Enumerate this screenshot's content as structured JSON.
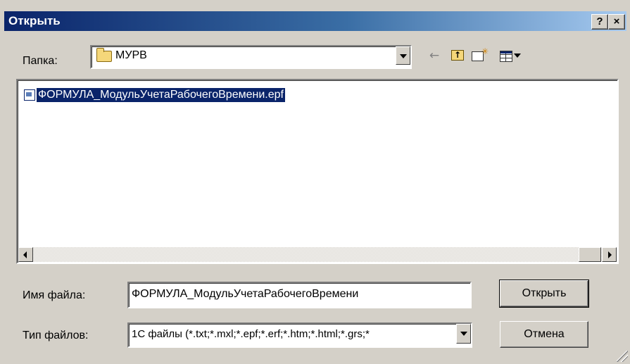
{
  "window": {
    "title": "Открыть",
    "help_label": "?",
    "close_label": "×"
  },
  "folder": {
    "label": "Папка:",
    "current": "МУРВ"
  },
  "toolbar": {
    "back_icon": "back-arrow-icon",
    "up_icon": "folder-up-icon",
    "new_folder_icon": "new-folder-icon",
    "view_icon": "view-menu-icon"
  },
  "files": [
    {
      "name": "ФОРМУЛА_МодульУчетаРабочегоВремени.epf",
      "selected": true
    }
  ],
  "filename": {
    "label": "Имя файла:",
    "value": "ФОРМУЛА_МодульУчетаРабочегоВремени"
  },
  "filetype": {
    "label": "Тип файлов:",
    "value": "1С файлы (*.txt;*.mxl;*.epf;*.erf;*.htm;*.html;*.grs;*"
  },
  "buttons": {
    "open": "Открыть",
    "cancel": "Отмена"
  },
  "colors": {
    "titlebar_start": "#0a246a",
    "titlebar_end": "#a6caf0",
    "face": "#d4d0c8",
    "selection": "#0a246a"
  }
}
